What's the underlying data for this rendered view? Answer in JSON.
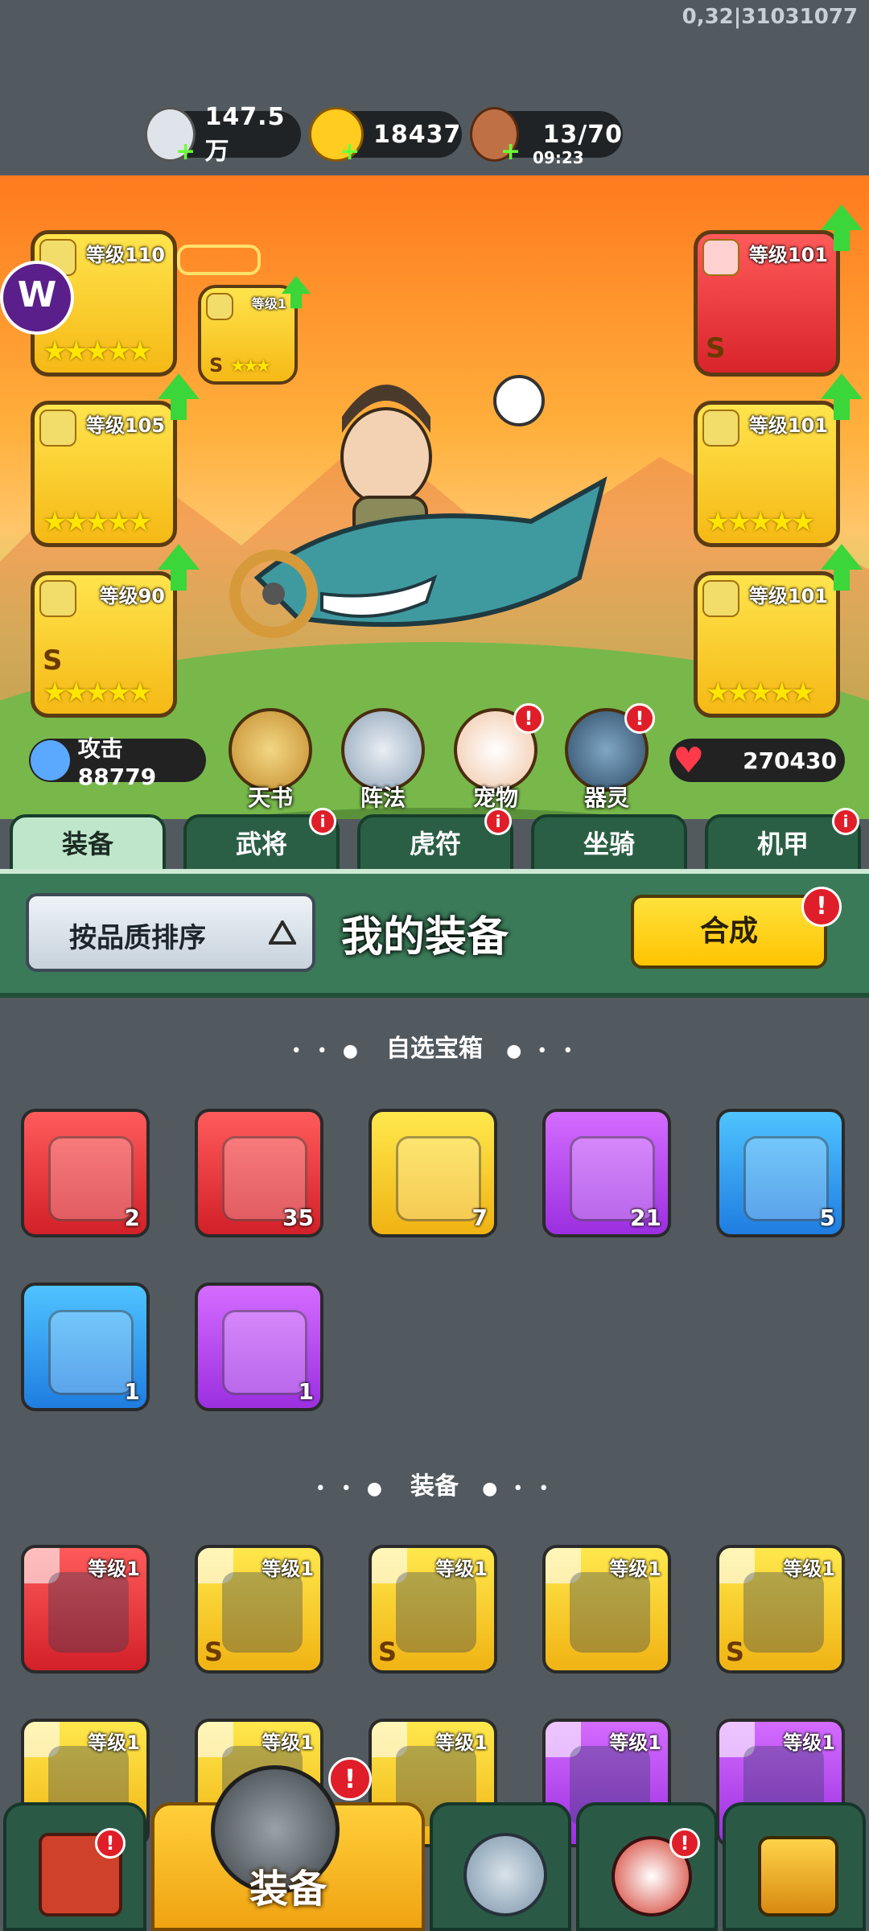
{
  "debug_text": "0,32|31031077",
  "resources": [
    {
      "icon": "silver-coin-icon",
      "value": "147.5万"
    },
    {
      "icon": "gold-ingot-icon",
      "value": "18437"
    },
    {
      "icon": "meat-drumstick-icon",
      "value": "13/70",
      "timer": "09:23"
    }
  ],
  "hero": {
    "left_slots": [
      {
        "level": "等级110",
        "grade": "S",
        "stars": "★★★★★"
      },
      {
        "level": "等级105",
        "grade": "",
        "stars": "★★★★★"
      },
      {
        "level": "等级90",
        "grade": "S",
        "stars": "★★★★★"
      }
    ],
    "small_slot": {
      "level": "等级1",
      "grade": "S",
      "stars": "★★★"
    },
    "right_slots": [
      {
        "level": "等级101",
        "grade": "S",
        "stars": ""
      },
      {
        "level": "等级101",
        "grade": "",
        "stars": "★★★★★"
      },
      {
        "level": "等级101",
        "grade": "",
        "stars": "★★★★★"
      }
    ],
    "attack_label": "攻击 88779",
    "hp_value": "270430",
    "circle_buttons": [
      {
        "label": "天书",
        "badge": ""
      },
      {
        "label": "阵法",
        "badge": ""
      },
      {
        "label": "宠物",
        "badge": "!"
      },
      {
        "label": "器灵",
        "badge": "!"
      }
    ]
  },
  "tabs": [
    {
      "label": "装备",
      "badge": ""
    },
    {
      "label": "武将",
      "badge": "i"
    },
    {
      "label": "虎符",
      "badge": "i"
    },
    {
      "label": "坐骑",
      "badge": ""
    },
    {
      "label": "机甲",
      "badge": "i"
    }
  ],
  "toolbar": {
    "sort_label": "按品质排序",
    "title": "我的装备",
    "compose_label": "合成",
    "compose_badge": "!"
  },
  "sections": {
    "chest_title": "自选宝箱",
    "equip_title": "装备"
  },
  "chests": [
    {
      "color": "red",
      "count": "2"
    },
    {
      "color": "red",
      "count": "35"
    },
    {
      "color": "yellow",
      "count": "7"
    },
    {
      "color": "purple",
      "count": "21"
    },
    {
      "color": "blue",
      "count": "5"
    },
    {
      "color": "blue",
      "count": "1"
    },
    {
      "color": "purple",
      "count": "1"
    }
  ],
  "equipment": [
    {
      "color": "red",
      "level": "等级1",
      "grade": ""
    },
    {
      "color": "yellow",
      "level": "等级1",
      "grade": "S"
    },
    {
      "color": "yellow",
      "level": "等级1",
      "grade": "S"
    },
    {
      "color": "yellow",
      "level": "等级1",
      "grade": ""
    },
    {
      "color": "yellow",
      "level": "等级1",
      "grade": "S"
    },
    {
      "color": "yellow",
      "level": "等级1",
      "grade": ""
    },
    {
      "color": "yellow",
      "level": "等级1",
      "grade": ""
    },
    {
      "color": "yellow",
      "level": "等级1",
      "grade": ""
    },
    {
      "color": "purple",
      "level": "等级1",
      "grade": ""
    },
    {
      "color": "purple",
      "level": "等级1",
      "grade": ""
    }
  ],
  "bottom_nav": {
    "active_label": "装备",
    "badges": [
      "!",
      "!"
    ]
  }
}
